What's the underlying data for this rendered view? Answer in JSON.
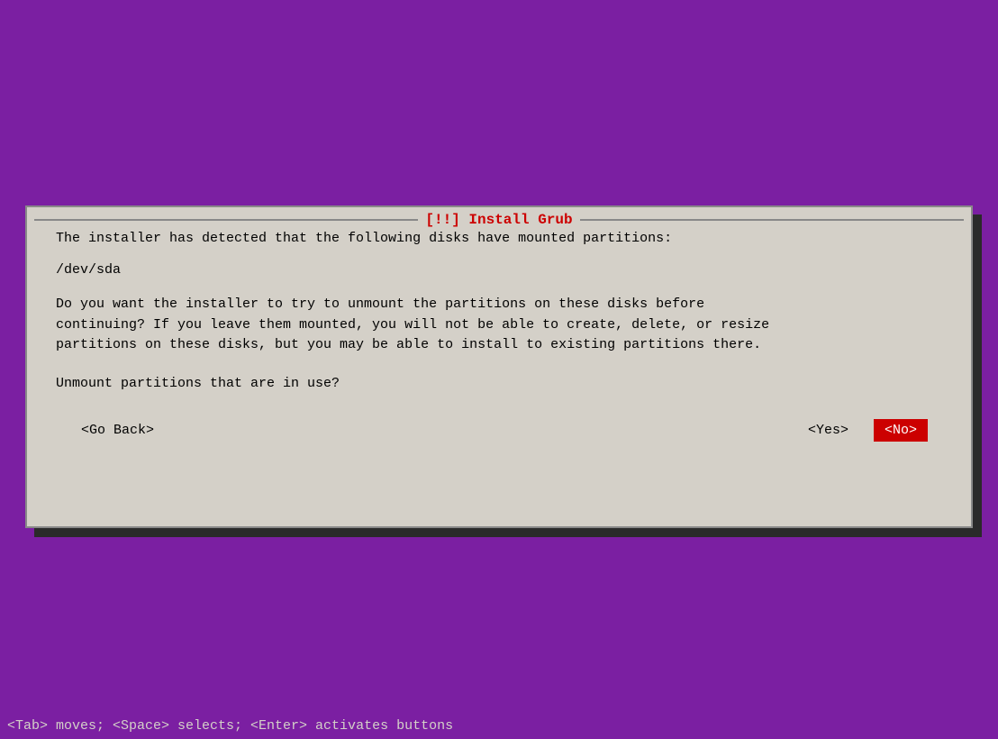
{
  "background_color": "#7B1FA2",
  "dialog": {
    "title": "[!!] Install Grub",
    "line1": "The installer has detected that the following disks have mounted partitions:",
    "device": "/dev/sda",
    "description_line1": "Do you want the installer to try to unmount the partitions on these disks before",
    "description_line2": "continuing?  If you leave them mounted, you will not be able to create, delete, or resize",
    "description_line3": "partitions on these disks, but you may be able to install to existing partitions there.",
    "question": "Unmount partitions that are in use?",
    "buttons": {
      "go_back": "<Go Back>",
      "yes": "<Yes>",
      "no": "<No>"
    }
  },
  "status_bar": "<Tab> moves; <Space> selects; <Enter> activates buttons"
}
